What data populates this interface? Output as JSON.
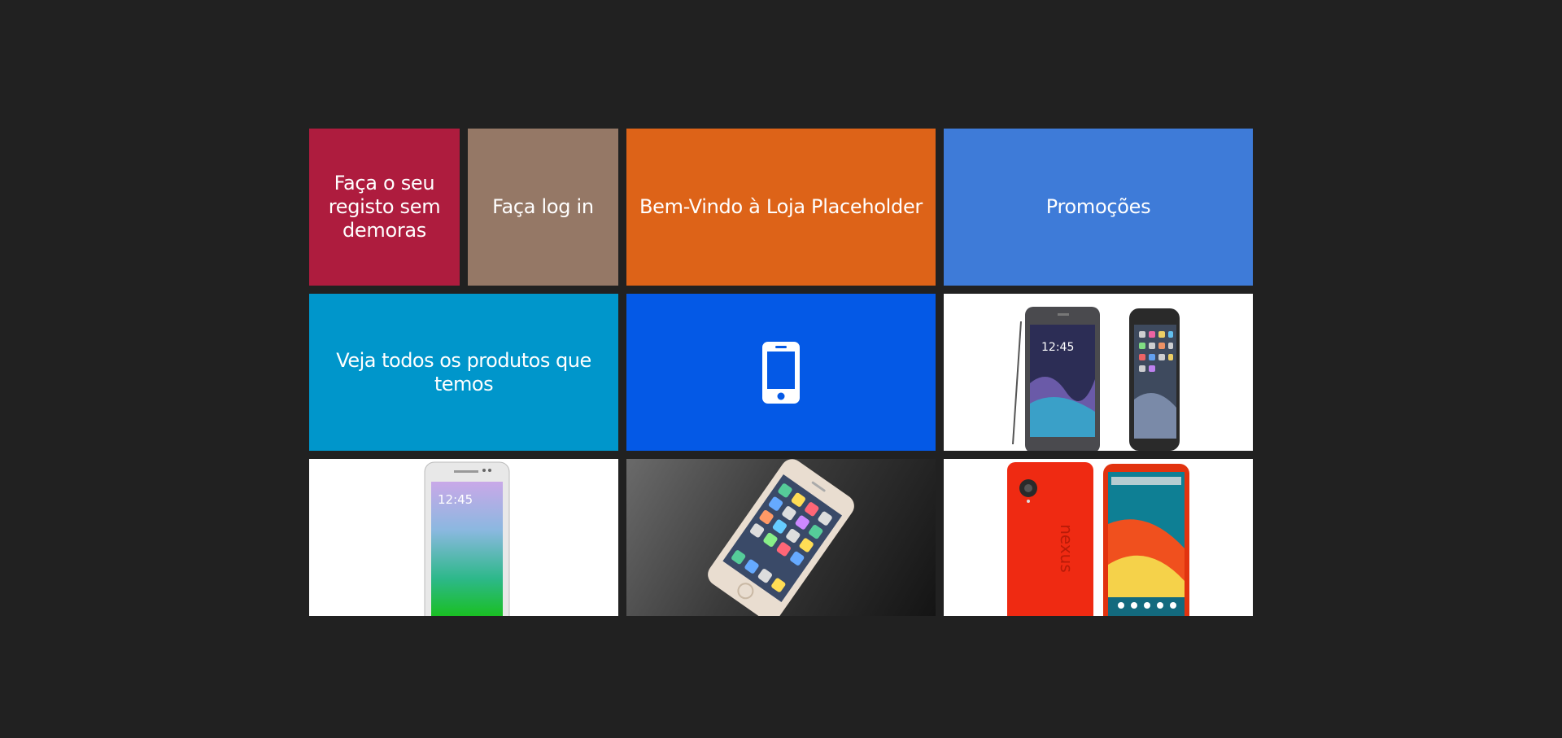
{
  "tiles": {
    "register": {
      "label": "Faça o seu registo sem demoras",
      "color": "#ae1c3e"
    },
    "login": {
      "label": "Faça log in",
      "color": "#957866"
    },
    "welcome": {
      "label": "Bem-Vindo à Loja Placeholder",
      "color": "#dd6318"
    },
    "promotions": {
      "label": "Promoções",
      "color": "#3e7bd8"
    },
    "all_products": {
      "label": "Veja todos os produtos que temos",
      "color": "#0096cb"
    },
    "phone_icon": {
      "icon": "smartphone-icon",
      "color": "#0459e6"
    },
    "product_images": [
      {
        "name": "galaxy-note-and-iphone-6"
      },
      {
        "name": "galaxy-alpha"
      },
      {
        "name": "iphone-5s"
      },
      {
        "name": "nexus-5-red"
      }
    ]
  }
}
